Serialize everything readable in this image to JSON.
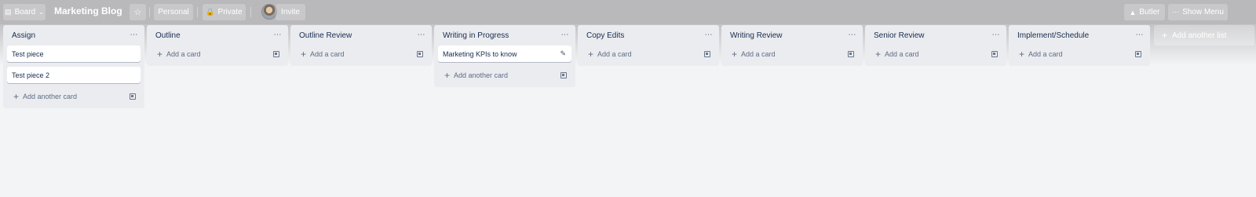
{
  "topbar": {
    "board_switcher": "Board",
    "board_title": "Marketing Blog",
    "team_label": "Personal",
    "visibility_label": "Private",
    "invite_label": "Invite",
    "butler_label": "Butler",
    "show_menu_label": "Show Menu"
  },
  "lists": [
    {
      "title": "Assign",
      "cards": [
        "Test piece",
        "Test piece 2"
      ],
      "add_label": "Add another card"
    },
    {
      "title": "Outline",
      "cards": [],
      "add_label": "Add a card"
    },
    {
      "title": "Outline Review",
      "cards": [],
      "add_label": "Add a card"
    },
    {
      "title": "Writing in Progress",
      "cards": [
        "Marketing KPIs to know"
      ],
      "add_label": "Add another card"
    },
    {
      "title": "Copy Edits",
      "cards": [],
      "add_label": "Add a card"
    },
    {
      "title": "Writing Review",
      "cards": [],
      "add_label": "Add a card"
    },
    {
      "title": "Senior Review",
      "cards": [],
      "add_label": "Add a card"
    },
    {
      "title": "Implement/Schedule",
      "cards": [],
      "add_label": "Add a card"
    }
  ],
  "add_list_label": "Add another list",
  "icons": {
    "list_menu": "ellipsis-icon",
    "add": "plus-icon",
    "template": "card-template-icon",
    "edit": "pencil-icon",
    "star": "star-icon",
    "lock": "lock-icon",
    "butler": "butler-icon",
    "menu": "ellipsis-icon"
  },
  "colors": {
    "topbar": "#b9b9bb",
    "list_bg": "#ebecf0",
    "board_bg": "#f3f4f6"
  }
}
